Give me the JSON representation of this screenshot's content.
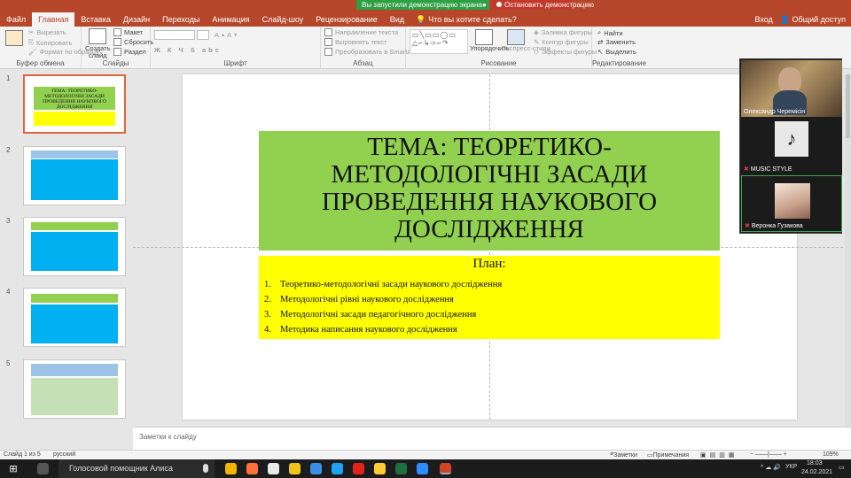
{
  "screen_share": {
    "status": "Вы запустили демонстрацию экрана",
    "stop_label": "Остановить демонстрацию"
  },
  "tabs": [
    "Файл",
    "Главная",
    "Вставка",
    "Дизайн",
    "Переходы",
    "Анимация",
    "Слайд-шоу",
    "Рецензирование",
    "Вид"
  ],
  "tell_me": "Что вы хотите сделать?",
  "signin": "Вход",
  "share": "Общий доступ",
  "ribbon": {
    "clipboard": {
      "cut": "Вырезать",
      "copy": "Копировать",
      "format_painter": "Формат по образцу",
      "label": "Буфер обмена"
    },
    "slides": {
      "new_slide": "Создать слайд",
      "layout": "Макет",
      "reset": "Сбросить",
      "section": "Раздел",
      "label": "Слайды"
    },
    "font": {
      "label": "Шрифт"
    },
    "paragraph": {
      "text_direction": "Направление текста",
      "align_text": "Выровнять текст",
      "smartart": "Преобразовать в SmartArt",
      "label": "Абзац"
    },
    "drawing": {
      "arrange": "Упорядочить",
      "quick_styles": "Экспресс-стили",
      "fill": "Заливка фигуры",
      "outline": "Контур фигуры",
      "effects": "Эффекты фигуры",
      "label": "Рисование"
    },
    "editing": {
      "find": "Найти",
      "replace": "Заменить",
      "select": "Выделить",
      "label": "Редактирование"
    }
  },
  "thumbnails": {
    "numbers": [
      "1",
      "2",
      "3",
      "4",
      "5"
    ],
    "slide1_title": "ТЕМА: ТЕОРЕТИКО-МЕТОДОЛОГІЧНІ ЗАСАДИ ПРОВЕДЕННЯ НАУКОВОГО ДОСЛІДЖЕННЯ"
  },
  "slide": {
    "title_lines": [
      "ТЕМА: ТЕОРЕТИКО-",
      "МЕТОДОЛОГІЧНІ ЗАСАДИ",
      "ПРОВЕДЕННЯ НАУКОВОГО",
      "ДОСЛІДЖЕННЯ"
    ],
    "plan_heading": "План:",
    "plan_items": [
      {
        "num": "1.",
        "text": "Теоретико-методологічні засади наукового дослідження"
      },
      {
        "num": "2.",
        "text": "Методологічні рівні наукового дослідження"
      },
      {
        "num": "3.",
        "text": "Методологічні засади педагогічного дослідження"
      },
      {
        "num": "4.",
        "text": "Методика написання наукового дослідження"
      }
    ],
    "colors": {
      "title_bg": "#92d050",
      "plan_bg": "#ffff00"
    }
  },
  "video": {
    "participants": [
      {
        "name": "Олександр Черемісін"
      },
      {
        "name": "MUSIC STYLE"
      },
      {
        "name": "Веронка Гузакова"
      }
    ]
  },
  "notes_placeholder": "Заметки к слайду",
  "status": {
    "slide_counter": "Слайд 1 из 5",
    "language": "русский",
    "notes": "Заметки",
    "comments": "Примечания",
    "zoom": "109%"
  },
  "taskbar": {
    "search": "Голосовой помощник Алиса",
    "lang": "УКР",
    "time": "18:03",
    "date": "24.02.2021"
  }
}
